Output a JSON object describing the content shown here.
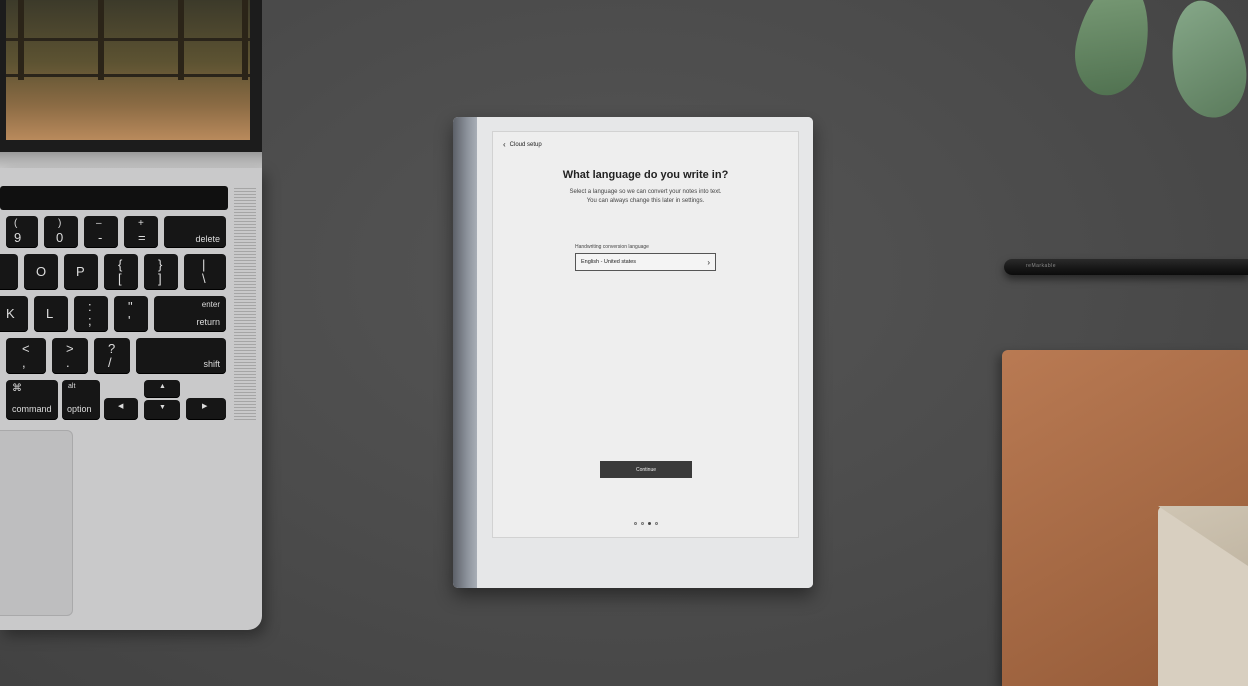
{
  "device_screen": {
    "back_link_label": "Cloud setup",
    "title": "What language do you write in?",
    "subtitle_line1": "Select a language so we can convert your notes into text.",
    "subtitle_line2": "You can always change this later in settings.",
    "field_label": "Handwriting conversion language",
    "selected_language": "English - United states",
    "continue_label": "Continue",
    "pagination": {
      "total": 4,
      "current": 3
    }
  },
  "keyboard": {
    "keys": [
      {
        "top": "(",
        "bottom": "9"
      },
      {
        "top": ")",
        "bottom": "0"
      },
      {
        "top": "–",
        "bottom": "-"
      },
      {
        "top": "+",
        "bottom": "="
      },
      {
        "top": "",
        "bottom": "delete"
      },
      {
        "top": "",
        "bottom": "O"
      },
      {
        "top": "",
        "bottom": "P"
      },
      {
        "top": "{",
        "bottom": "["
      },
      {
        "top": "}",
        "bottom": "]"
      },
      {
        "top": "|",
        "bottom": "\\"
      },
      {
        "top": "",
        "bottom": "K"
      },
      {
        "top": "",
        "bottom": "L"
      },
      {
        "top": ":",
        "bottom": ";"
      },
      {
        "top": "\"",
        "bottom": "'"
      },
      {
        "top": "enter",
        "bottom": "return"
      },
      {
        "top": "<",
        "bottom": ","
      },
      {
        "top": ">",
        "bottom": "."
      },
      {
        "top": "?",
        "bottom": "/"
      },
      {
        "top": "",
        "bottom": "shift"
      },
      {
        "top": "⌘",
        "bottom": "command"
      },
      {
        "top": "alt",
        "bottom": "option"
      },
      {
        "top": "",
        "bottom": "◀"
      },
      {
        "top": "▲",
        "bottom": "▼"
      },
      {
        "top": "",
        "bottom": "▶"
      }
    ]
  },
  "pen": {
    "label": "reMarkable"
  }
}
